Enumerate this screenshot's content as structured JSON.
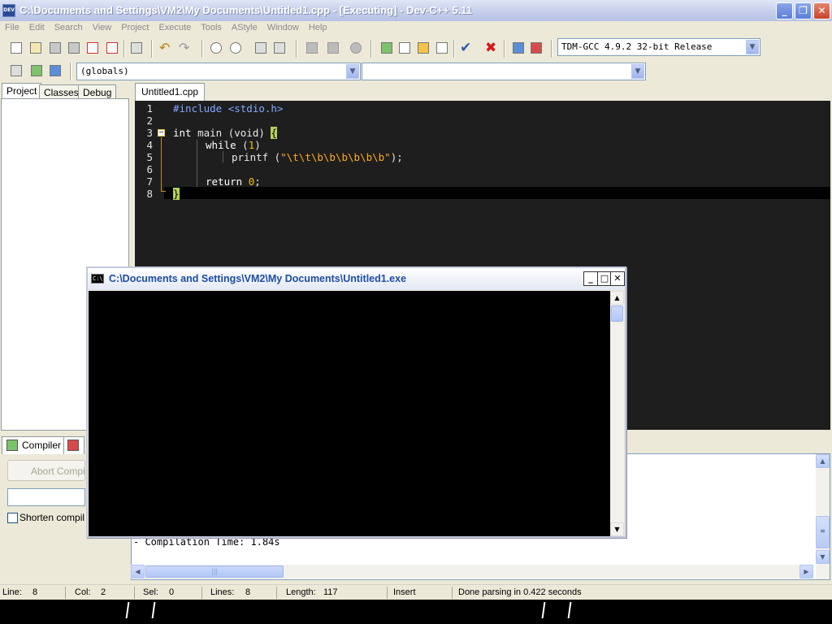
{
  "window": {
    "title": "C:\\Documents and Settings\\VM2\\My Documents\\Untitled1.cpp - [Executing] - Dev-C++ 5.11",
    "app_icon_text": "DEV",
    "minimize": "_",
    "maximize": "❐",
    "close": "✕"
  },
  "menu": [
    "File",
    "Edit",
    "Search",
    "View",
    "Project",
    "Execute",
    "Tools",
    "AStyle",
    "Window",
    "Help"
  ],
  "toolbar": {
    "compiler_select": "TDM-GCC 4.9.2 32-bit Release",
    "scope_select": "(globals)",
    "function_select": ""
  },
  "left_panel": {
    "tabs": [
      "Project",
      "Classes",
      "Debug"
    ]
  },
  "editor": {
    "file_tab": "Untitled1.cpp",
    "line_numbers": [
      "1",
      "2",
      "3",
      "4",
      "5",
      "6",
      "7",
      "8"
    ],
    "lines": {
      "l1_pre": "#include <stdio.h>",
      "l3_kw": "int",
      "l3_rest": " main (void) ",
      "l3_brace": "{",
      "l4_kw": "while",
      "l4_open": " (",
      "l4_num": "1",
      "l4_close": ")",
      "l5_fn": "printf (",
      "l5_str": "\"\\t\\t\\b\\b\\b\\b\\b\\b\"",
      "l5_end": ");",
      "l7_kw": "return",
      "l7_sp": " ",
      "l7_num": "0",
      "l7_end": ";",
      "l8_brace": "}"
    }
  },
  "bottom_panel": {
    "tab_compiler": "Compiler",
    "abort_button": "Abort Compilation",
    "shorten_label": "Shorten compiler paths",
    "log_line": "- Compilation Time: 1.84s"
  },
  "statusbar": {
    "line_label": "Line:",
    "line_value": "8",
    "col_label": "Col:",
    "col_value": "2",
    "sel_label": "Sel:",
    "sel_value": "0",
    "lines_label": "Lines:",
    "lines_value": "8",
    "length_label": "Length:",
    "length_value": "117",
    "mode": "Insert",
    "message": "Done parsing in 0.422 seconds"
  },
  "console": {
    "title": "C:\\Documents and Settings\\VM2\\My Documents\\Untitled1.exe",
    "icon_text": "C:\\",
    "minimize": "_",
    "maximize": "□",
    "close": "✕"
  },
  "colors": {
    "editor_bg": "#1e1e1e",
    "preprocessor": "#7fa7ff",
    "number": "#f0c000",
    "string": "#ffaa22",
    "brace_highlight": "#b4d256",
    "console_title": "#1d4ea5"
  }
}
